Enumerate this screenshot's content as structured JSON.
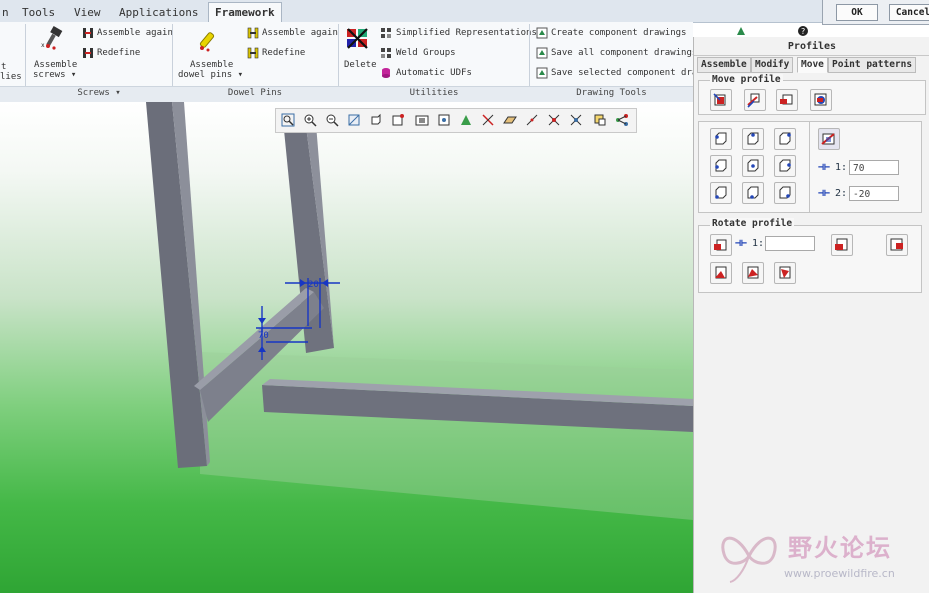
{
  "ribbon_tabs": [
    {
      "label": "n"
    },
    {
      "label": "Tools"
    },
    {
      "label": "View"
    },
    {
      "label": "Applications"
    },
    {
      "label": "Framework",
      "active": true
    }
  ],
  "ribbon": {
    "assemble_screws": "Assemble",
    "assemble_screws_2": "screws ▾",
    "assemble_again_1": "Assemble again",
    "redefine_1": "Redefine",
    "assemble_dowel": "Assemble",
    "assemble_dowel_2": "dowel pins ▾",
    "assemble_again_2": "Assemble again",
    "redefine_2": "Redefine",
    "delete": "Delete",
    "simplified_rep": "Simplified Representations",
    "weld_groups": "Weld Groups",
    "automatic_udfs": "Automatic UDFs",
    "create_component_drawings": "Create component drawings",
    "save_all_component_drawings": "Save all component drawings",
    "save_selected_component_drawings": "Save selected component drawi",
    "left_cut_1": "t",
    "left_cut_2": "lies",
    "groups": {
      "screws": "Screws ▾",
      "dowel_pins": "Dowel Pins",
      "utilities": "Utilities",
      "drawing_tools": "Drawing Tools"
    }
  },
  "dialog": {
    "ok": "OK",
    "cancel": "Cancel"
  },
  "panel": {
    "title": "Profiles",
    "tabs": [
      {
        "label": "Assemble"
      },
      {
        "label": "Modify"
      },
      {
        "label": "Move",
        "active": true
      },
      {
        "label": "Point patterns"
      }
    ],
    "move_profile": "Move profile",
    "rotate_profile": "Rotate profile",
    "offset1_label": "1:",
    "offset1_value": "70",
    "offset2_label": "2:",
    "offset2_value": "-20",
    "rotate_label": "1:",
    "rotate_value": ""
  },
  "viewport": {
    "dim_top": "20",
    "dim_side": "70"
  },
  "watermark": {
    "title": "野火论坛",
    "url": "www.proewildfire.cn"
  },
  "colors": {
    "accent": "#cc2222",
    "bg_green": "#2fa534",
    "tab_bg": "#dfe6ee"
  }
}
